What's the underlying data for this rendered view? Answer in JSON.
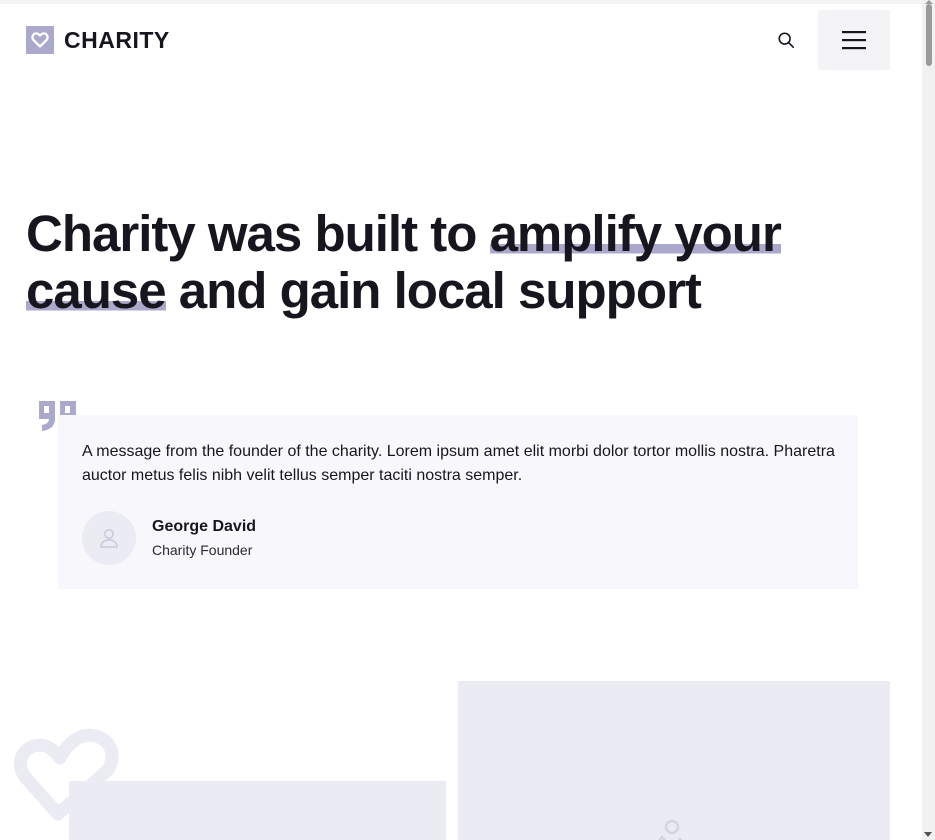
{
  "header": {
    "brand": "CHARITY",
    "logo_icon": "heart-icon",
    "search_icon": "search-icon",
    "menu_icon": "hamburger-menu-icon"
  },
  "hero": {
    "part1": "Charity was built to ",
    "highlight1": "amplify your",
    "part2": " ",
    "highlight2": "cause",
    "part3": " and gain local support"
  },
  "testimonial": {
    "quote_icon": "quote-icon",
    "text": "A message from the founder of the charity. Lorem ipsum amet elit morbi dolor tortor mollis nostra. Pharetra auctor metus felis nibh velit tellus semper taciti nostra semper.",
    "avatar_icon": "user-icon",
    "author_name": "George David",
    "author_role": "Charity Founder"
  },
  "gallery": {
    "decor_icon": "heart-outline-icon",
    "image_icon": "image-placeholder-icon"
  },
  "colors": {
    "accent": "#aaa8cb",
    "text": "#17161f",
    "card_bg": "#f8f8fc",
    "placeholder_bg": "#ebebf3",
    "menu_bg": "#f4f4f6"
  }
}
